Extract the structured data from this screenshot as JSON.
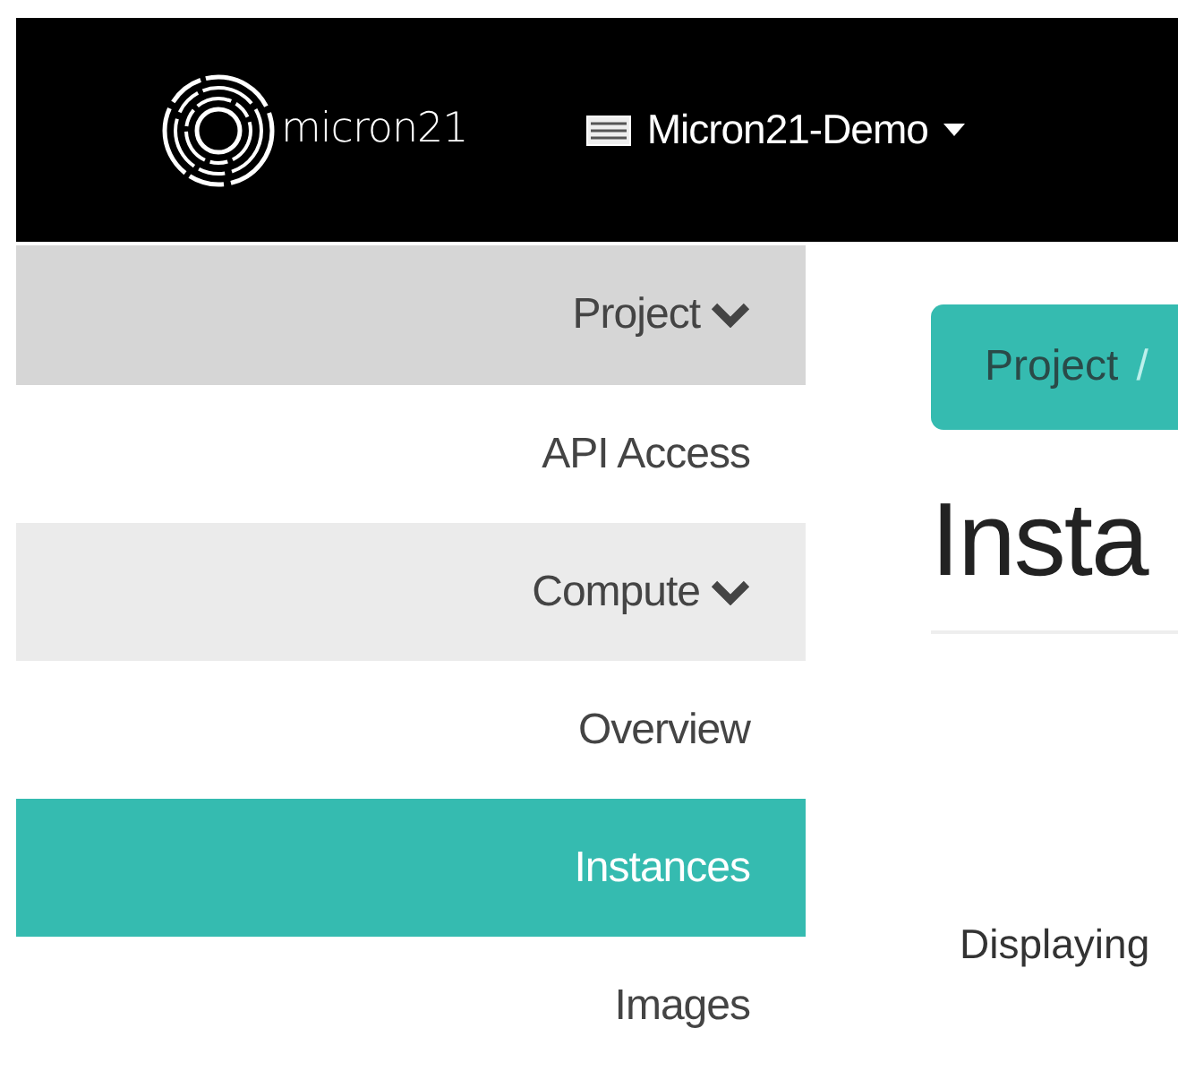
{
  "header": {
    "logo_text": "micron21",
    "project_menu": {
      "label": "Micron21-Demo",
      "expanded": false
    }
  },
  "sidebar": {
    "items": [
      {
        "kind": "section",
        "label": "Project",
        "expanded": true,
        "children": [
          {
            "kind": "link",
            "label": "API Access",
            "selected": false
          },
          {
            "kind": "section",
            "label": "Compute",
            "expanded": true,
            "children": [
              {
                "kind": "link",
                "label": "Overview",
                "selected": false
              },
              {
                "kind": "link",
                "label": "Instances",
                "selected": true
              },
              {
                "kind": "link",
                "label": "Images",
                "selected": false
              }
            ]
          }
        ]
      }
    ]
  },
  "breadcrumb": [
    {
      "label": "Project",
      "separator": "/"
    }
  ],
  "page_title": "Insta",
  "table_info": "Displaying"
}
